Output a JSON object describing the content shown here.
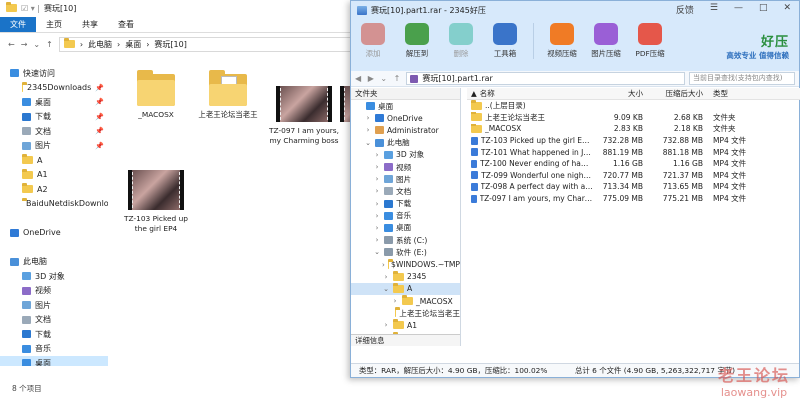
{
  "explorer": {
    "title": "赛玩[10]",
    "tabs": [
      "文件",
      "主页",
      "共享",
      "查看"
    ],
    "breadcrumb": [
      "此电脑",
      "桌面",
      "赛玩[10]"
    ],
    "nav": [
      {
        "label": "快速访问",
        "icon": "star-icon"
      },
      {
        "label": "2345Downloads",
        "icon": "folder-icon",
        "pinned": true
      },
      {
        "label": "桌面",
        "icon": "desktop-icon",
        "pinned": true
      },
      {
        "label": "下载",
        "icon": "download-icon",
        "pinned": true
      },
      {
        "label": "文档",
        "icon": "document-icon",
        "pinned": true
      },
      {
        "label": "图片",
        "icon": "picture-icon",
        "pinned": true
      },
      {
        "label": "A",
        "icon": "folder-icon"
      },
      {
        "label": "A1",
        "icon": "folder-icon"
      },
      {
        "label": "A2",
        "icon": "folder-icon"
      },
      {
        "label": "BaiduNetdiskDownlo",
        "icon": "folder-icon"
      },
      {
        "label": "",
        "icon": ""
      },
      {
        "label": "OneDrive",
        "icon": "cloud-icon"
      },
      {
        "label": "",
        "icon": ""
      },
      {
        "label": "此电脑",
        "icon": "computer-icon"
      },
      {
        "label": "3D 对象",
        "icon": "cube-icon"
      },
      {
        "label": "视频",
        "icon": "video-icon"
      },
      {
        "label": "图片",
        "icon": "picture-icon"
      },
      {
        "label": "文档",
        "icon": "document-icon"
      },
      {
        "label": "下载",
        "icon": "download-icon"
      },
      {
        "label": "音乐",
        "icon": "music-icon"
      },
      {
        "label": "桌面",
        "icon": "desktop-icon",
        "selected": true
      },
      {
        "label": "系统 (C:)",
        "icon": "drive-icon"
      },
      {
        "label": "软件 (E:)",
        "icon": "drive-icon"
      }
    ],
    "items": [
      {
        "label": "_MACOSX",
        "kind": "folder"
      },
      {
        "label": "上老王论坛当老王",
        "kind": "folder-doc"
      },
      {
        "label": "TZ-097 I am yours, my Charming boss",
        "kind": "video"
      },
      {
        "label": "",
        "kind": "video"
      },
      {
        "label": "TZ-103 Picked up the girl EP4",
        "kind": "video"
      }
    ],
    "status": "8 个项目"
  },
  "rar": {
    "title": "赛玩[10].part1.rar - 2345好压",
    "window_controls": [
      "反馈",
      "☰",
      "—",
      "□",
      "✕"
    ],
    "tools": [
      {
        "label": "添加",
        "icon": "add-archive-icon",
        "color": "#d04a3c",
        "disabled": true
      },
      {
        "label": "解压到",
        "icon": "extract-icon",
        "color": "#4aa04c"
      },
      {
        "label": "删除",
        "icon": "delete-icon",
        "color": "#3fb9a6",
        "disabled": true
      },
      {
        "label": "工具箱",
        "icon": "toolbox-icon",
        "color": "#3a74c9"
      },
      {
        "label": "视频压缩",
        "icon": "video-compress-icon",
        "color": "#f07b25"
      },
      {
        "label": "图片压缩",
        "icon": "image-compress-icon",
        "color": "#9a5fd6"
      },
      {
        "label": "PDF压缩",
        "icon": "pdf-compress-icon",
        "color": "#e5574a"
      }
    ],
    "brand": {
      "name": "好压",
      "slogan": "高效专业  值得信赖"
    },
    "path": "赛玩[10].part1.rar",
    "search_placeholder": "当前目录查找(支持包内查找)",
    "tree_header": "文件夹",
    "tree": [
      {
        "label": "桌面",
        "indent": 0,
        "icon": "desktop-icon"
      },
      {
        "label": "OneDrive",
        "indent": 1,
        "icon": "cloud-icon",
        "chev": "›"
      },
      {
        "label": "Administrator",
        "indent": 1,
        "icon": "user-icon",
        "chev": "›"
      },
      {
        "label": "此电脑",
        "indent": 1,
        "icon": "computer-icon",
        "chev": "⌄"
      },
      {
        "label": "3D 对象",
        "indent": 2,
        "icon": "cube-icon",
        "chev": "›"
      },
      {
        "label": "视频",
        "indent": 2,
        "icon": "video-icon",
        "chev": "›"
      },
      {
        "label": "图片",
        "indent": 2,
        "icon": "picture-icon",
        "chev": "›"
      },
      {
        "label": "文档",
        "indent": 2,
        "icon": "document-icon",
        "chev": "›"
      },
      {
        "label": "下载",
        "indent": 2,
        "icon": "download-icon",
        "chev": "›"
      },
      {
        "label": "音乐",
        "indent": 2,
        "icon": "music-icon",
        "chev": "›"
      },
      {
        "label": "桌面",
        "indent": 2,
        "icon": "desktop-icon",
        "chev": "›"
      },
      {
        "label": "系统 (C:)",
        "indent": 2,
        "icon": "drive-icon",
        "chev": "›"
      },
      {
        "label": "软件 (E:)",
        "indent": 2,
        "icon": "drive-icon",
        "chev": "⌄"
      },
      {
        "label": "$WINDOWS.~TMP",
        "indent": 3,
        "icon": "folder-icon",
        "chev": "›"
      },
      {
        "label": "2345",
        "indent": 3,
        "icon": "folder-icon",
        "chev": "›"
      },
      {
        "label": "A",
        "indent": 3,
        "icon": "folder-icon",
        "chev": "⌄",
        "selected": true
      },
      {
        "label": "_MACOSX",
        "indent": 4,
        "icon": "folder-icon",
        "chev": "›"
      },
      {
        "label": "上老王论坛当老王",
        "indent": 4,
        "icon": "folder-icon",
        "chev": ""
      },
      {
        "label": "A1",
        "indent": 3,
        "icon": "folder-icon",
        "chev": "›"
      },
      {
        "label": "A2",
        "indent": 3,
        "icon": "folder-icon",
        "chev": "›"
      }
    ],
    "tree_footer": "详细信息",
    "columns": {
      "name": "名称",
      "size": "大小",
      "packed": "压缩后大小",
      "type": "类型"
    },
    "files": [
      {
        "name": "..(上层目录)",
        "size": "",
        "packed": "",
        "type": "",
        "kind": "folder"
      },
      {
        "name": "上老王论坛当老王",
        "size": "9.09 KB",
        "packed": "2.68 KB",
        "type": "文件夹",
        "kind": "folder"
      },
      {
        "name": "_MACOSX",
        "size": "2.83 KB",
        "packed": "2.18 KB",
        "type": "文件夹",
        "kind": "folder"
      },
      {
        "name": "TZ-103 Picked up the girl EP4.mp4",
        "size": "732.28 MB",
        "packed": "732.88 MB",
        "type": "MP4 文件",
        "kind": "video"
      },
      {
        "name": "TZ-101 What happened in Jail.mp4",
        "size": "881.19 MB",
        "packed": "881.18 MB",
        "type": "MP4 文件",
        "kind": "video"
      },
      {
        "name": "TZ-100 Never ending of happiness.mp4",
        "size": "1.16 GB",
        "packed": "1.16 GB",
        "type": "MP4 文件",
        "kind": "video"
      },
      {
        "name": "TZ-099 Wonderful one night.mp4",
        "size": "720.77 MB",
        "packed": "721.37 MB",
        "type": "MP4 文件",
        "kind": "video"
      },
      {
        "name": "TZ-098 A perfect day with a girl.mp4",
        "size": "713.34 MB",
        "packed": "713.65 MB",
        "type": "MP4 文件",
        "kind": "video"
      },
      {
        "name": "TZ-097 I am yours, my Charming boss.mp4",
        "size": "775.09 MB",
        "packed": "775.21 MB",
        "type": "MP4 文件",
        "kind": "video"
      }
    ],
    "status_left": "类型：RAR，解压后大小：4.90 GB，压缩比：100.02%",
    "status_right": "总计 6 个文件 (4.90 GB, 5,263,322,717 字节)"
  },
  "watermark": {
    "line1": "老王论坛",
    "line2": "laowang.vip"
  }
}
